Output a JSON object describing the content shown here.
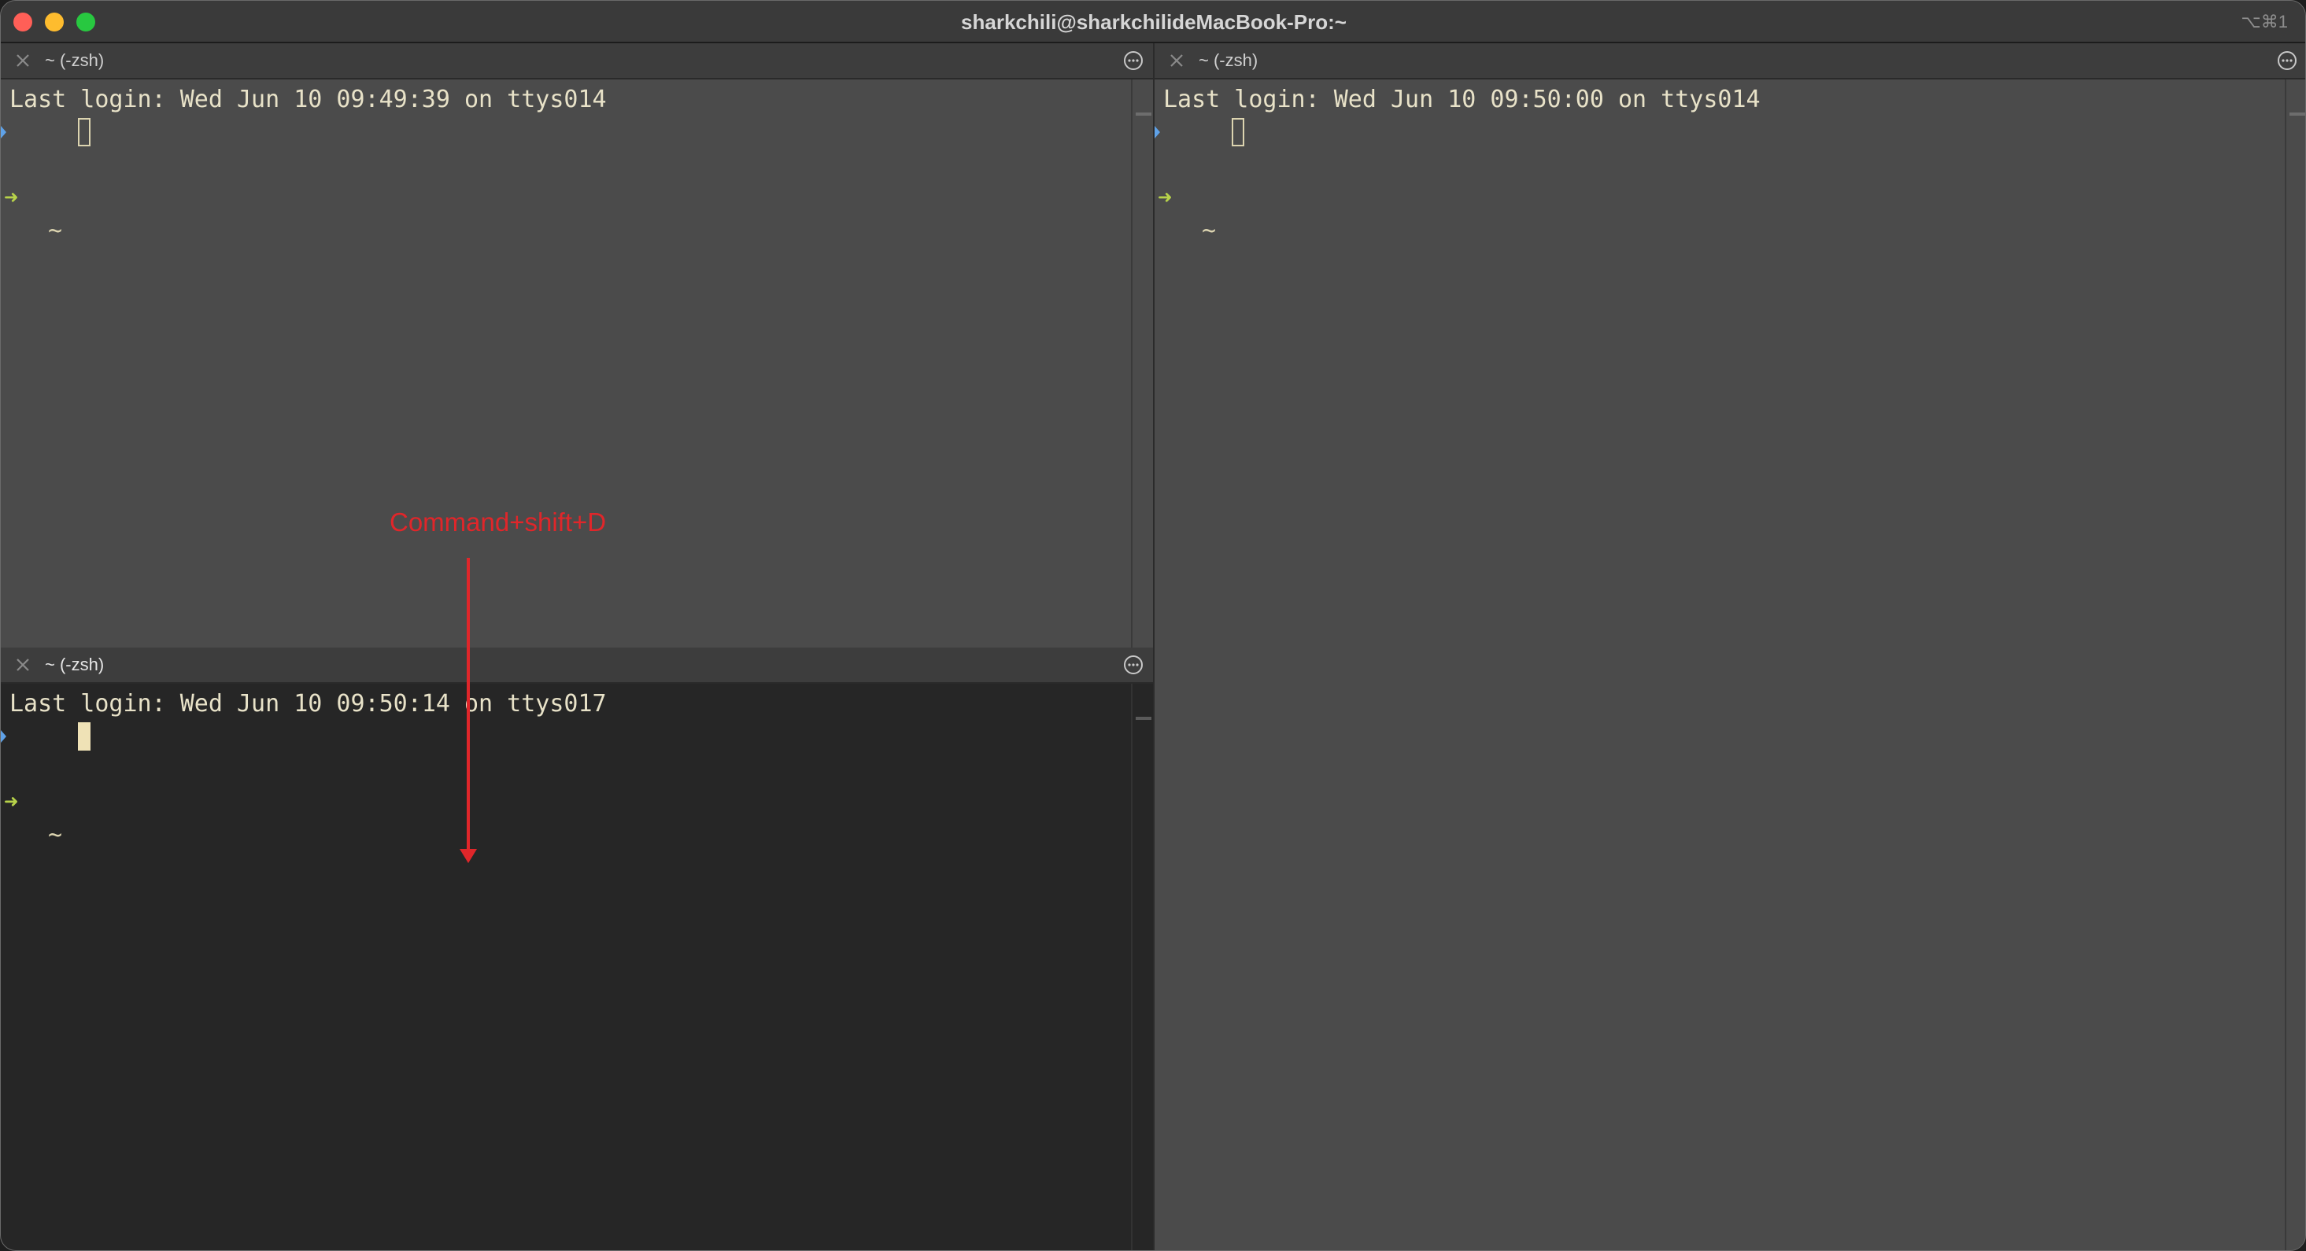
{
  "window": {
    "title": "sharkchili@sharkchilideMacBook-Pro:~",
    "shortcut": "⌥⌘1",
    "colors": {
      "close": "#ff5f57",
      "minimize": "#febc2e",
      "maximize": "#28c840",
      "annotation": "#e0262a"
    }
  },
  "panes": [
    {
      "tab_title": "~ (-zsh)",
      "login_line": "Last login: Wed Jun 10 09:49:39 on ttys014",
      "prompt_symbol": "➜",
      "prompt_dir": "~",
      "active": false
    },
    {
      "tab_title": "~ (-zsh)",
      "login_line": "Last login: Wed Jun 10 09:50:00 on ttys014",
      "prompt_symbol": "➜",
      "prompt_dir": "~",
      "active": false
    },
    {
      "tab_title": "~ (-zsh)",
      "login_line": "Last login: Wed Jun 10 09:50:14 on ttys017",
      "prompt_symbol": "➜",
      "prompt_dir": "~",
      "active": true
    }
  ],
  "annotation": {
    "label": "Command+shift+D"
  },
  "icons": {
    "close_pane": "close-icon",
    "pane_menu": "more-icon"
  }
}
